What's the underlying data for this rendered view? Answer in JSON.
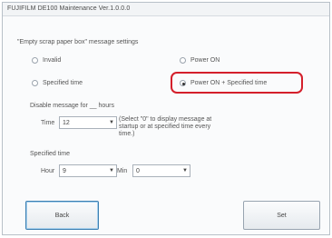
{
  "window": {
    "title": "FUJIFILM DE100 Maintenance Ver.1.0.0.0"
  },
  "section": {
    "heading": "\"Empty scrap paper box\" message settings"
  },
  "radios": {
    "invalid": {
      "label": "Invalid",
      "checked": false
    },
    "power_on": {
      "label": "Power ON",
      "checked": false
    },
    "specified_time": {
      "label": "Specified time",
      "checked": false
    },
    "power_on_specified": {
      "label": "Power ON + Specified time",
      "checked": true
    }
  },
  "disable": {
    "label": "Disable message for __ hours",
    "time_label": "Time",
    "time_value": "12",
    "note": "(Select \"0\" to display message at startup or at specified time every time.)"
  },
  "specified": {
    "label": "Specified time",
    "hour_label": "Hour",
    "hour_value": "9",
    "min_label": "Min",
    "min_value": "0"
  },
  "buttons": {
    "back": "Back",
    "set": "Set"
  },
  "colors": {
    "highlight": "#d41f2b",
    "focus_border": "#3c7fb1"
  }
}
